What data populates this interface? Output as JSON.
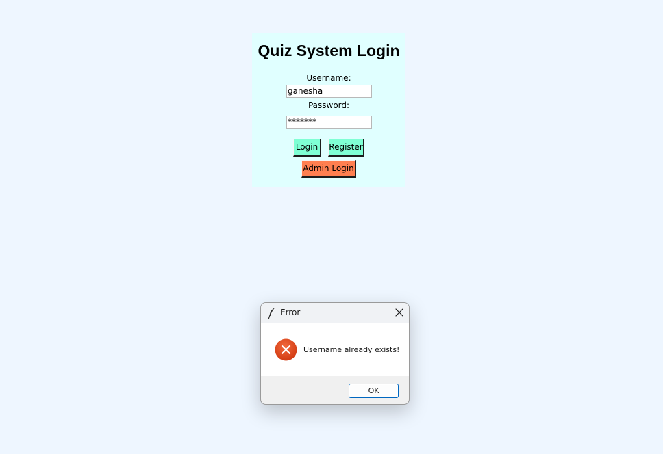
{
  "login": {
    "title": "Quiz System Login",
    "username_label": "Username:",
    "username_value": "ganesha",
    "password_label": "Password:",
    "password_value": "*******",
    "login_button": "Login",
    "register_button": "Register",
    "admin_button": "Admin Login",
    "panel_color": "#e0ffff",
    "button_color": "#7fffd4",
    "admin_button_color": "#ff7f50"
  },
  "dialog": {
    "title": "Error",
    "message": "Username already exists!",
    "ok_button": "OK",
    "app_icon": "feather-icon",
    "close_icon": "close-icon",
    "status_icon": "error-icon",
    "accent": "#0067c0",
    "error_color": "#e0401c"
  }
}
